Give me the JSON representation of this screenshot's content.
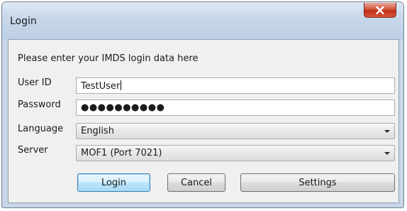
{
  "window": {
    "title": "Login",
    "close_icon": "close-x-icon"
  },
  "form": {
    "prompt": "Please enter your IMDS login data here",
    "user_id": {
      "label": "User ID",
      "value": "TestUser"
    },
    "password": {
      "label": "Password",
      "masked_value": "●●●●●●●●●●"
    },
    "language": {
      "label": "Language",
      "selected": "English"
    },
    "server": {
      "label": "Server",
      "selected": "MOF1 (Port 7021)"
    }
  },
  "buttons": {
    "login": "Login",
    "cancel": "Cancel",
    "settings": "Settings"
  }
}
